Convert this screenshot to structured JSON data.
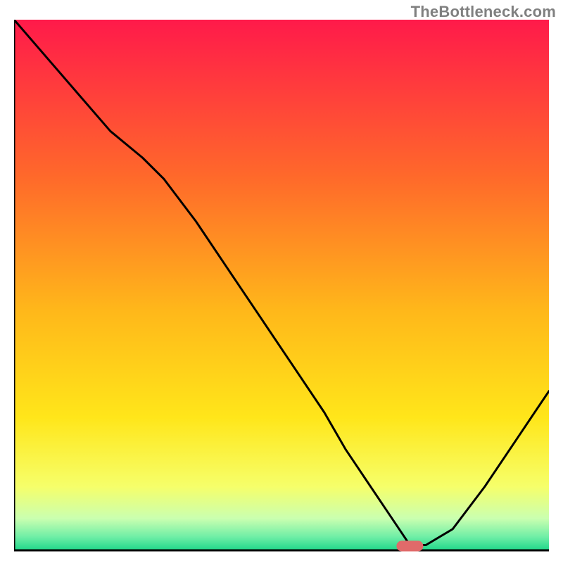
{
  "watermark": "TheBottleneck.com",
  "chart_data": {
    "type": "line",
    "title": "",
    "xlabel": "",
    "ylabel": "",
    "xlim": [
      0,
      100
    ],
    "ylim": [
      0,
      100
    ],
    "grid": false,
    "legend": false,
    "annotations": [
      {
        "name": "watermark",
        "text": "TheBottleneck.com",
        "position": "top-right"
      }
    ],
    "series": [
      {
        "name": "curve",
        "x": [
          0,
          6,
          12,
          18,
          24,
          28,
          34,
          40,
          46,
          52,
          58,
          62,
          66,
          70,
          72,
          74,
          77,
          82,
          88,
          94,
          100
        ],
        "y": [
          100,
          93,
          86,
          79,
          74,
          70,
          62,
          53,
          44,
          35,
          26,
          19,
          13,
          7,
          4,
          1,
          1,
          4,
          12,
          21,
          30
        ]
      }
    ],
    "marker": {
      "name": "optimum-marker",
      "x": 74,
      "y": 0.8,
      "w": 5,
      "h": 2,
      "rx": 1,
      "color": "#e06a6a"
    },
    "background_gradient": {
      "stops": [
        {
          "offset": 0.0,
          "color": "#ff1a4a"
        },
        {
          "offset": 0.3,
          "color": "#ff6a2a"
        },
        {
          "offset": 0.55,
          "color": "#ffb81a"
        },
        {
          "offset": 0.75,
          "color": "#ffe61a"
        },
        {
          "offset": 0.88,
          "color": "#f6ff6a"
        },
        {
          "offset": 0.94,
          "color": "#caffb0"
        },
        {
          "offset": 0.975,
          "color": "#6eeea6"
        },
        {
          "offset": 1.0,
          "color": "#1fd68a"
        }
      ]
    }
  }
}
